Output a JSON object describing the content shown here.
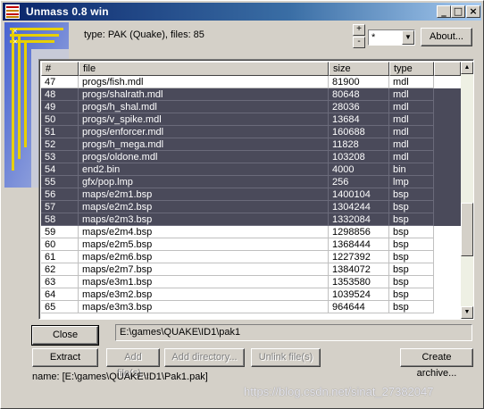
{
  "window": {
    "title": "Unmass 0.8 win",
    "minimize_glyph": "_",
    "maximize_glyph": "□",
    "close_glyph": "×"
  },
  "info": {
    "text": "type: PAK (Quake), files: 85"
  },
  "spinner": {
    "up": "+",
    "down": "-"
  },
  "filter": {
    "value": "*",
    "arrow": "▼"
  },
  "buttons": {
    "about": "About...",
    "close": "Close",
    "extract": "Extract",
    "add_files": "Add file(s)...",
    "add_directory": "Add directory...",
    "unlink_files": "Unlink file(s)",
    "create_archive": "Create archive..."
  },
  "table": {
    "columns": [
      "#",
      "file",
      "size",
      "type"
    ],
    "rows": [
      {
        "num": "47",
        "file": "progs/fish.mdl",
        "size": "81900",
        "type": "mdl",
        "selected": false
      },
      {
        "num": "48",
        "file": "progs/shalrath.mdl",
        "size": "80648",
        "type": "mdl",
        "selected": true
      },
      {
        "num": "49",
        "file": "progs/h_shal.mdl",
        "size": "28036",
        "type": "mdl",
        "selected": true
      },
      {
        "num": "50",
        "file": "progs/v_spike.mdl",
        "size": "13684",
        "type": "mdl",
        "selected": true
      },
      {
        "num": "51",
        "file": "progs/enforcer.mdl",
        "size": "160688",
        "type": "mdl",
        "selected": true
      },
      {
        "num": "52",
        "file": "progs/h_mega.mdl",
        "size": "11828",
        "type": "mdl",
        "selected": true
      },
      {
        "num": "53",
        "file": "progs/oldone.mdl",
        "size": "103208",
        "type": "mdl",
        "selected": true
      },
      {
        "num": "54",
        "file": "end2.bin",
        "size": "4000",
        "type": "bin",
        "selected": true
      },
      {
        "num": "55",
        "file": "gfx/pop.lmp",
        "size": "256",
        "type": "lmp",
        "selected": true
      },
      {
        "num": "56",
        "file": "maps/e2m1.bsp",
        "size": "1400104",
        "type": "bsp",
        "selected": true
      },
      {
        "num": "57",
        "file": "maps/e2m2.bsp",
        "size": "1304244",
        "type": "bsp",
        "selected": true
      },
      {
        "num": "58",
        "file": "maps/e2m3.bsp",
        "size": "1332084",
        "type": "bsp",
        "selected": true
      },
      {
        "num": "59",
        "file": "maps/e2m4.bsp",
        "size": "1298856",
        "type": "bsp",
        "selected": false
      },
      {
        "num": "60",
        "file": "maps/e2m5.bsp",
        "size": "1368444",
        "type": "bsp",
        "selected": false
      },
      {
        "num": "61",
        "file": "maps/e2m6.bsp",
        "size": "1227392",
        "type": "bsp",
        "selected": false
      },
      {
        "num": "62",
        "file": "maps/e2m7.bsp",
        "size": "1384072",
        "type": "bsp",
        "selected": false
      },
      {
        "num": "63",
        "file": "maps/e3m1.bsp",
        "size": "1353580",
        "type": "bsp",
        "selected": false
      },
      {
        "num": "64",
        "file": "maps/e3m2.bsp",
        "size": "1039524",
        "type": "bsp",
        "selected": false
      },
      {
        "num": "65",
        "file": "maps/e3m3.bsp",
        "size": "964644",
        "type": "bsp",
        "selected": false
      }
    ]
  },
  "scrollbar": {
    "up": "▲",
    "down": "▼"
  },
  "path": "E:\\games\\QUAKE\\ID1\\pak1",
  "status": "name: [E:\\games\\QUAKE\\ID1\\Pak1.pak]",
  "watermark": "https://blog.csdn.net/sinat_27382047",
  "colors": {
    "title_gradient_start": "#0a246a",
    "selected_row": "#4a4a5a",
    "face": "#d4d0c8"
  }
}
